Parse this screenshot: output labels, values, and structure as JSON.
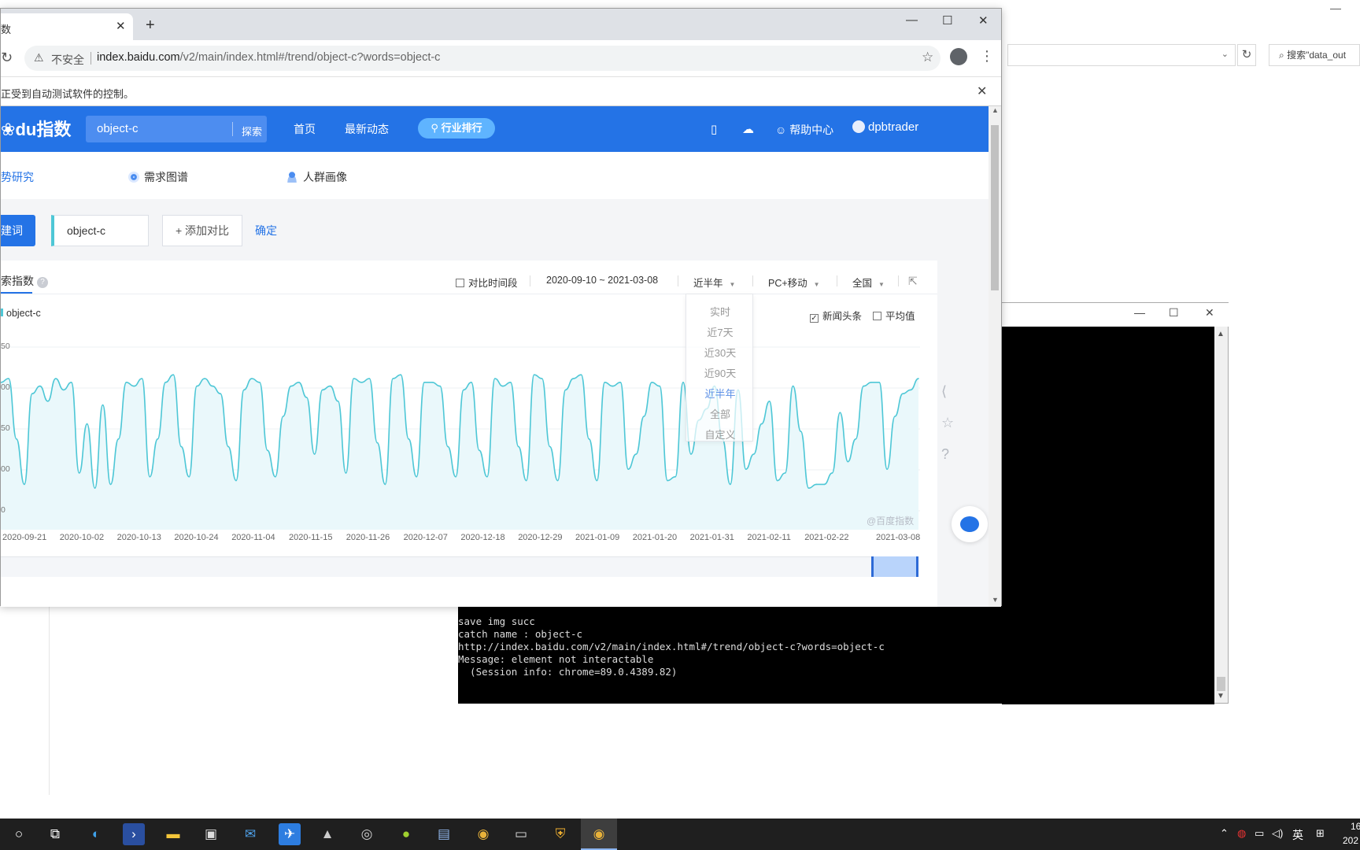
{
  "explorer": {
    "search_placeholder": "搜索\"data_out",
    "refresh_icon": "refresh-icon",
    "dropdown_icon": "chevron-down-icon"
  },
  "console": {
    "lines": [
      "save img succ",
      "catch name : object-c",
      "http://index.baidu.com/v2/main/index.html#/trend/object-c?words=object-c",
      "Message: element not interactable",
      "  (Session info: chrome=89.0.4389.82)"
    ]
  },
  "browser": {
    "tab_title": "数",
    "url_prefix": "index.baidu.com",
    "url_path": "/v2/main/index.html#/trend/object-c?words=object-c",
    "security_label": "不安全",
    "infobar_text": "正受到自动测试软件的控制。"
  },
  "baidu": {
    "logo_text": "du指数",
    "search_value": "object-c",
    "search_button": "探索",
    "nav": [
      "首页",
      "最新动态"
    ],
    "rank_button": "行业排行",
    "help": "帮助中心",
    "username": "dpbtrader",
    "subnav": [
      "势研究",
      "需求图谱",
      "人群画像"
    ],
    "keyword_button": "建词",
    "keyword_value": "object-c",
    "add_compare": "+ 添加对比",
    "confirm": "确定",
    "card_title": "索指数",
    "compare_period": "对比时间段",
    "date_range": "2020-09-10 ~ 2021-03-08",
    "period_select": "近半年",
    "device_select": "PC+移动",
    "region_select": "全国",
    "news_checkbox": "新闻头条",
    "avg_checkbox": "平均值",
    "watermark": "@百度指数",
    "dropdown_options": [
      "实时",
      "近7天",
      "近30天",
      "近90天",
      "近半年",
      "全部",
      "自定义"
    ],
    "selected_option": "近半年"
  },
  "chart_data": {
    "type": "line",
    "title": "",
    "xlabel": "",
    "ylabel": "",
    "y_tick_labels": [
      "50",
      "00",
      "50",
      "00",
      "0"
    ],
    "ylim": [
      0,
      250
    ],
    "x_tick_labels": [
      "2020-09-21",
      "2020-10-02",
      "2020-10-13",
      "2020-10-24",
      "2020-11-04",
      "2020-11-15",
      "2020-11-26",
      "2020-12-07",
      "2020-12-18",
      "2020-12-29",
      "2021-01-09",
      "2021-01-20",
      "2021-01-31",
      "2021-02-11",
      "2021-02-22",
      "2021-03-08"
    ],
    "series": [
      {
        "name": "object-c",
        "color": "#4ec7d6",
        "values": [
          195,
          200,
          120,
          60,
          180,
          190,
          170,
          200,
          185,
          195,
          75,
          140,
          55,
          165,
          60,
          120,
          195,
          190,
          200,
          70,
          120,
          195,
          205,
          110,
          70,
          190,
          200,
          190,
          180,
          110,
          65,
          185,
          200,
          195,
          105,
          70,
          150,
          190,
          195,
          175,
          100,
          185,
          190,
          170,
          75,
          200,
          195,
          200,
          115,
          60,
          200,
          205,
          120,
          70,
          195,
          195,
          190,
          110,
          70,
          185,
          195,
          105,
          70,
          200,
          190,
          195,
          110,
          65,
          205,
          200,
          110,
          65,
          185,
          200,
          205,
          120,
          65,
          195,
          190,
          195,
          80,
          100,
          150,
          195,
          190,
          65,
          70,
          195,
          100,
          145,
          160,
          190,
          120,
          60,
          185,
          80,
          100,
          140,
          170,
          65,
          75,
          190,
          130,
          55,
          60,
          60,
          75,
          155,
          90,
          120,
          190,
          195,
          195,
          80,
          150,
          180,
          185,
          200
        ]
      }
    ],
    "grid": true,
    "legend": "top-left"
  },
  "taskbar": {
    "tray_ime": "英",
    "clock_time": "16",
    "clock_date": "202"
  }
}
